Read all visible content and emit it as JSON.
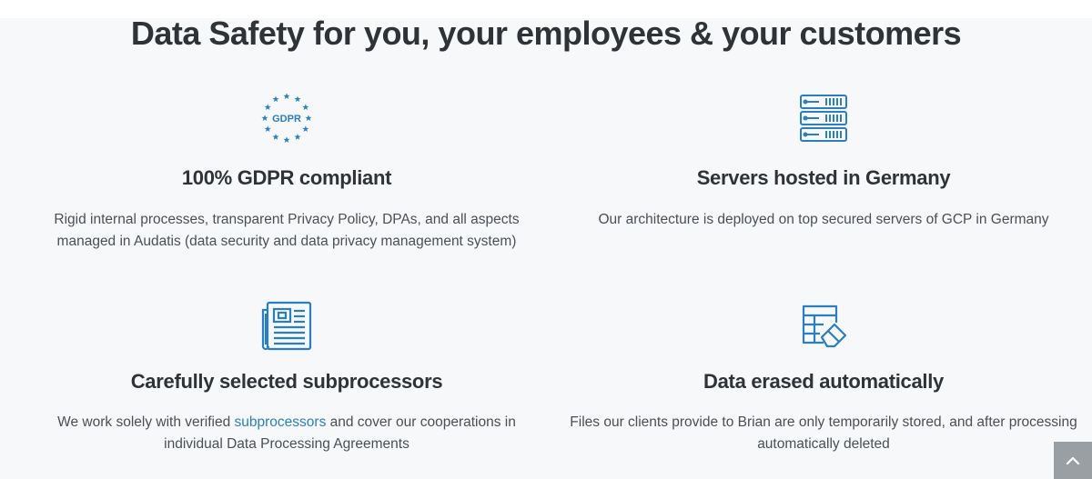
{
  "section": {
    "title": "Data Safety for you, your employees & your customers"
  },
  "features": [
    {
      "title": "100% GDPR compliant",
      "icon": "gdpr-stars-icon",
      "icon_label": "GDPR",
      "description": "Rigid internal processes, transparent Privacy Policy, DPAs, and all aspects managed in Audatis (data security and data privacy management system)"
    },
    {
      "title": "Servers hosted in Germany",
      "icon": "server-rack-icon",
      "description": "Our architecture is deployed on top secured servers of GCP in Germany"
    },
    {
      "title": "Carefully selected subprocessors",
      "icon": "newspaper-icon",
      "description_before": "We work solely with verified ",
      "description_link": "subprocessors",
      "description_after": " and cover our cooperations in individual Data Processing Agreements"
    },
    {
      "title": "Data erased automatically",
      "icon": "table-eraser-icon",
      "description": "Files our clients provide to Brian are only temporarily stored, and after processing automatically deleted"
    }
  ],
  "scroll_top": {
    "icon": "chevron-up-icon"
  },
  "colors": {
    "background": "#f6f8fa",
    "icon_blue": "#2b7fc0",
    "heading": "#2f3337",
    "body_text": "#4b5056",
    "link": "#2b7fc0",
    "scroll_button": "#9a9fa4"
  }
}
